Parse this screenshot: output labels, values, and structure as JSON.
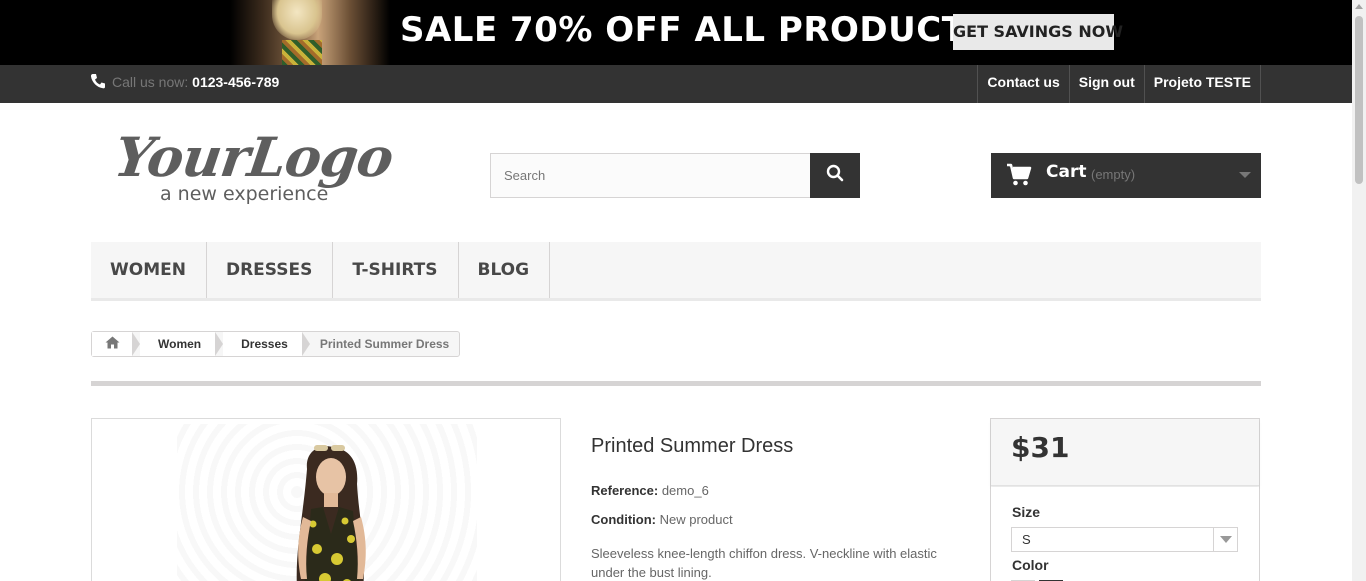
{
  "banner": {
    "headline": "SALE 70% OFF ALL PRODUCTS",
    "cta_label": "GET SAVINGS NOW"
  },
  "topbar": {
    "call_prefix": "Call us now:",
    "phone": "0123-456-789",
    "links": [
      "Contact us",
      "Sign out",
      "Projeto TESTE"
    ]
  },
  "logo": {
    "main": "YourLogo",
    "tagline": "a new experience"
  },
  "search": {
    "placeholder": "Search"
  },
  "cart": {
    "label": "Cart",
    "status": "(empty)"
  },
  "menu": {
    "items": [
      "WOMEN",
      "DRESSES",
      "T-SHIRTS",
      "BLOG"
    ]
  },
  "breadcrumb": {
    "items": [
      "Women",
      "Dresses"
    ],
    "current": "Printed Summer Dress"
  },
  "product": {
    "title": "Printed Summer Dress",
    "reference_label": "Reference:",
    "reference_value": "demo_6",
    "condition_label": "Condition:",
    "condition_value": "New product",
    "description": "Sleeveless knee-length chiffon dress. V-neckline with elastic under the bust lining."
  },
  "buybox": {
    "price": "$31",
    "size_label": "Size",
    "size_selected": "S",
    "color_label": "Color"
  },
  "colors": {
    "topbar_bg": "#333333",
    "banner_bg": "#000000",
    "accent_dark": "#333333",
    "menu_bg": "#f6f6f6"
  }
}
